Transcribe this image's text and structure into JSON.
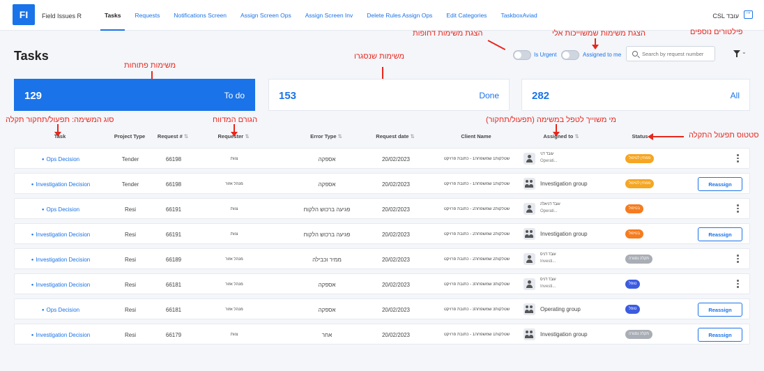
{
  "nav": {
    "logo": "FI",
    "app_name": "Field Issues R",
    "tabs": [
      {
        "label": "Tasks",
        "active": true
      },
      {
        "label": "Requests"
      },
      {
        "label": "Notifications Screen"
      },
      {
        "label": "Assign Screen Ops"
      },
      {
        "label": "Assign Screen Inv"
      },
      {
        "label": "Delete Rules Assign Ops"
      },
      {
        "label": "Edit Categories"
      },
      {
        "label": "TaskboxAviad"
      }
    ],
    "user": "CSL עובד"
  },
  "annotations": {
    "open_tasks": "משימות פתוחות",
    "closed_tasks": "משימות שנסגרו",
    "urgent_display": "הצגת משימות דחופות",
    "assigned_to_me_display": "הצגת משימות שמשוייכות אלי",
    "extra_filters": "פילטורים נוספים",
    "task_type": "סוג המשימה: תפעול/תחקור תקלה",
    "reporter": "הגורם המדווח",
    "assigned_to": "מי משוייך לטפל במשימה (תפעול/תחקור)",
    "status": "סטטוס תפעול התקלה"
  },
  "page": {
    "title": "Tasks"
  },
  "filters": {
    "urgent_label": "Is Urgent",
    "assigned_label": "Assigned to me",
    "search_placeholder": "Search by request number"
  },
  "summary": {
    "todo": {
      "count": "129",
      "label": "To do"
    },
    "done": {
      "count": "153",
      "label": "Done"
    },
    "all": {
      "count": "282",
      "label": "All"
    }
  },
  "table": {
    "headers": [
      "Task",
      "Project Type",
      "Request #",
      "Requester",
      "Error Type",
      "Request date",
      "Client Name",
      "Assigned to",
      "Status"
    ],
    "rows": [
      {
        "task": "Ops Decision",
        "project_type": "Tender",
        "request_no": "66198",
        "requester": "צוות",
        "error_type": "אספקה",
        "date": "20/02/2023",
        "client": "שטלקות1 שמשפחה1 - כתובת פרויקט",
        "assignee_type": "person",
        "assignee_name": "עובד דני",
        "assignee_sub": "Operati...",
        "status": "ממתין לטיפול",
        "status_color": "#f5a623",
        "action": "kebab"
      },
      {
        "task": "Investigation Decision",
        "project_type": "Tender",
        "request_no": "66198",
        "requester": "מנהל אזור",
        "error_type": "אספקה",
        "date": "20/02/2023",
        "client": "שטלקות1 שמשפחה1 - כתובת פרויקט",
        "assignee_type": "group",
        "assignee_name": "Investigation group",
        "assignee_sub": "",
        "status": "ממתין לטיפול",
        "status_color": "#f5a623",
        "action": "Reassign"
      },
      {
        "task": "Ops Decision",
        "project_type": "Resi",
        "request_no": "66191",
        "requester": "צוות",
        "error_type": "פגיעה ברכוש הלקוח",
        "date": "20/02/2023",
        "client": "שטלקות2 שמשפחה2 - כתובת פרויקט",
        "assignee_type": "person",
        "assignee_name": "עובד דניאלה",
        "assignee_sub": "Operati...",
        "status": "בטיפול",
        "status_color": "#f57c1f",
        "action": "kebab"
      },
      {
        "task": "Investigation Decision",
        "project_type": "Resi",
        "request_no": "66191",
        "requester": "צוות",
        "error_type": "פגיעה ברכוש הלקוח",
        "date": "20/02/2023",
        "client": "שטלקות2 שמשפחה2 - כתובת פרויקט",
        "assignee_type": "group",
        "assignee_name": "Investigation group",
        "assignee_sub": "",
        "status": "בטיפול",
        "status_color": "#f57c1f",
        "action": "Reassign"
      },
      {
        "task": "Investigation Decision",
        "project_type": "Resi",
        "request_no": "66189",
        "requester": "מנהל אזור",
        "error_type": "ממיר וכבילה",
        "date": "20/02/2023",
        "client": "שטלקות2 שמשפחה2 - כתובת פרויקט",
        "assignee_type": "person",
        "assignee_name": "עובד דניס",
        "assignee_sub": "Investi...",
        "status": "תקלה נסגרה",
        "status_color": "#a9adb5",
        "action": "kebab"
      },
      {
        "task": "Investigation Decision",
        "project_type": "Resi",
        "request_no": "66181",
        "requester": "מנהל אזור",
        "error_type": "אספקה",
        "date": "20/02/2023",
        "client": "שטלקות3 שמשפחה3 - כתובת פרויקט",
        "assignee_type": "person",
        "assignee_name": "עובד דניס",
        "assignee_sub": "Investi...",
        "status": "טופל",
        "status_color": "#3b5be0",
        "action": "kebab"
      },
      {
        "task": "Ops Decision",
        "project_type": "Resi",
        "request_no": "66181",
        "requester": "מנהל אזור",
        "error_type": "אספקה",
        "date": "20/02/2023",
        "client": "שטלקות3 שמשפחה3 - כתובת פרויקט",
        "assignee_type": "group",
        "assignee_name": "Operating group",
        "assignee_sub": "",
        "status": "טופל",
        "status_color": "#3b5be0",
        "action": "Reassign"
      },
      {
        "task": "Investigation Decision",
        "project_type": "Resi",
        "request_no": "66179",
        "requester": "צוות",
        "error_type": "אחר",
        "date": "20/02/2023",
        "client": "שטלקות1 שמשפחה1 - כתובת פרויקט",
        "assignee_type": "group",
        "assignee_name": "Investigation group",
        "assignee_sub": "",
        "status": "תקלה נסגרה",
        "status_color": "#a9adb5",
        "action": "Reassign"
      }
    ]
  }
}
